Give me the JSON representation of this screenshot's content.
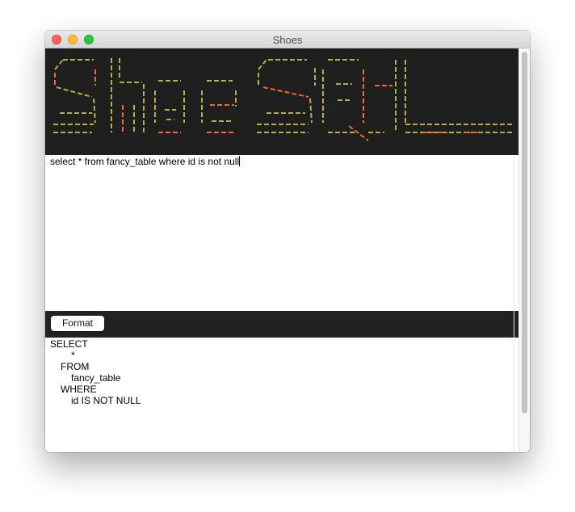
{
  "window": {
    "title": "Shoes"
  },
  "banner": {
    "text": "ShoeSQL",
    "colors": {
      "olive": "#b8b13f",
      "orange": "#f0692f",
      "background": "#1f1f1f"
    }
  },
  "editor": {
    "query": "select * from fancy_table where id is not null"
  },
  "toolbar": {
    "format_label": "Format"
  },
  "output": {
    "lines": [
      {
        "text": "SELECT",
        "indent": 0
      },
      {
        "text": "*",
        "indent": 2
      },
      {
        "text": "FROM",
        "indent": 1
      },
      {
        "text": "fancy_table",
        "indent": 2
      },
      {
        "text": "WHERE",
        "indent": 1
      },
      {
        "text": "id IS NOT NULL",
        "indent": 2
      }
    ]
  }
}
